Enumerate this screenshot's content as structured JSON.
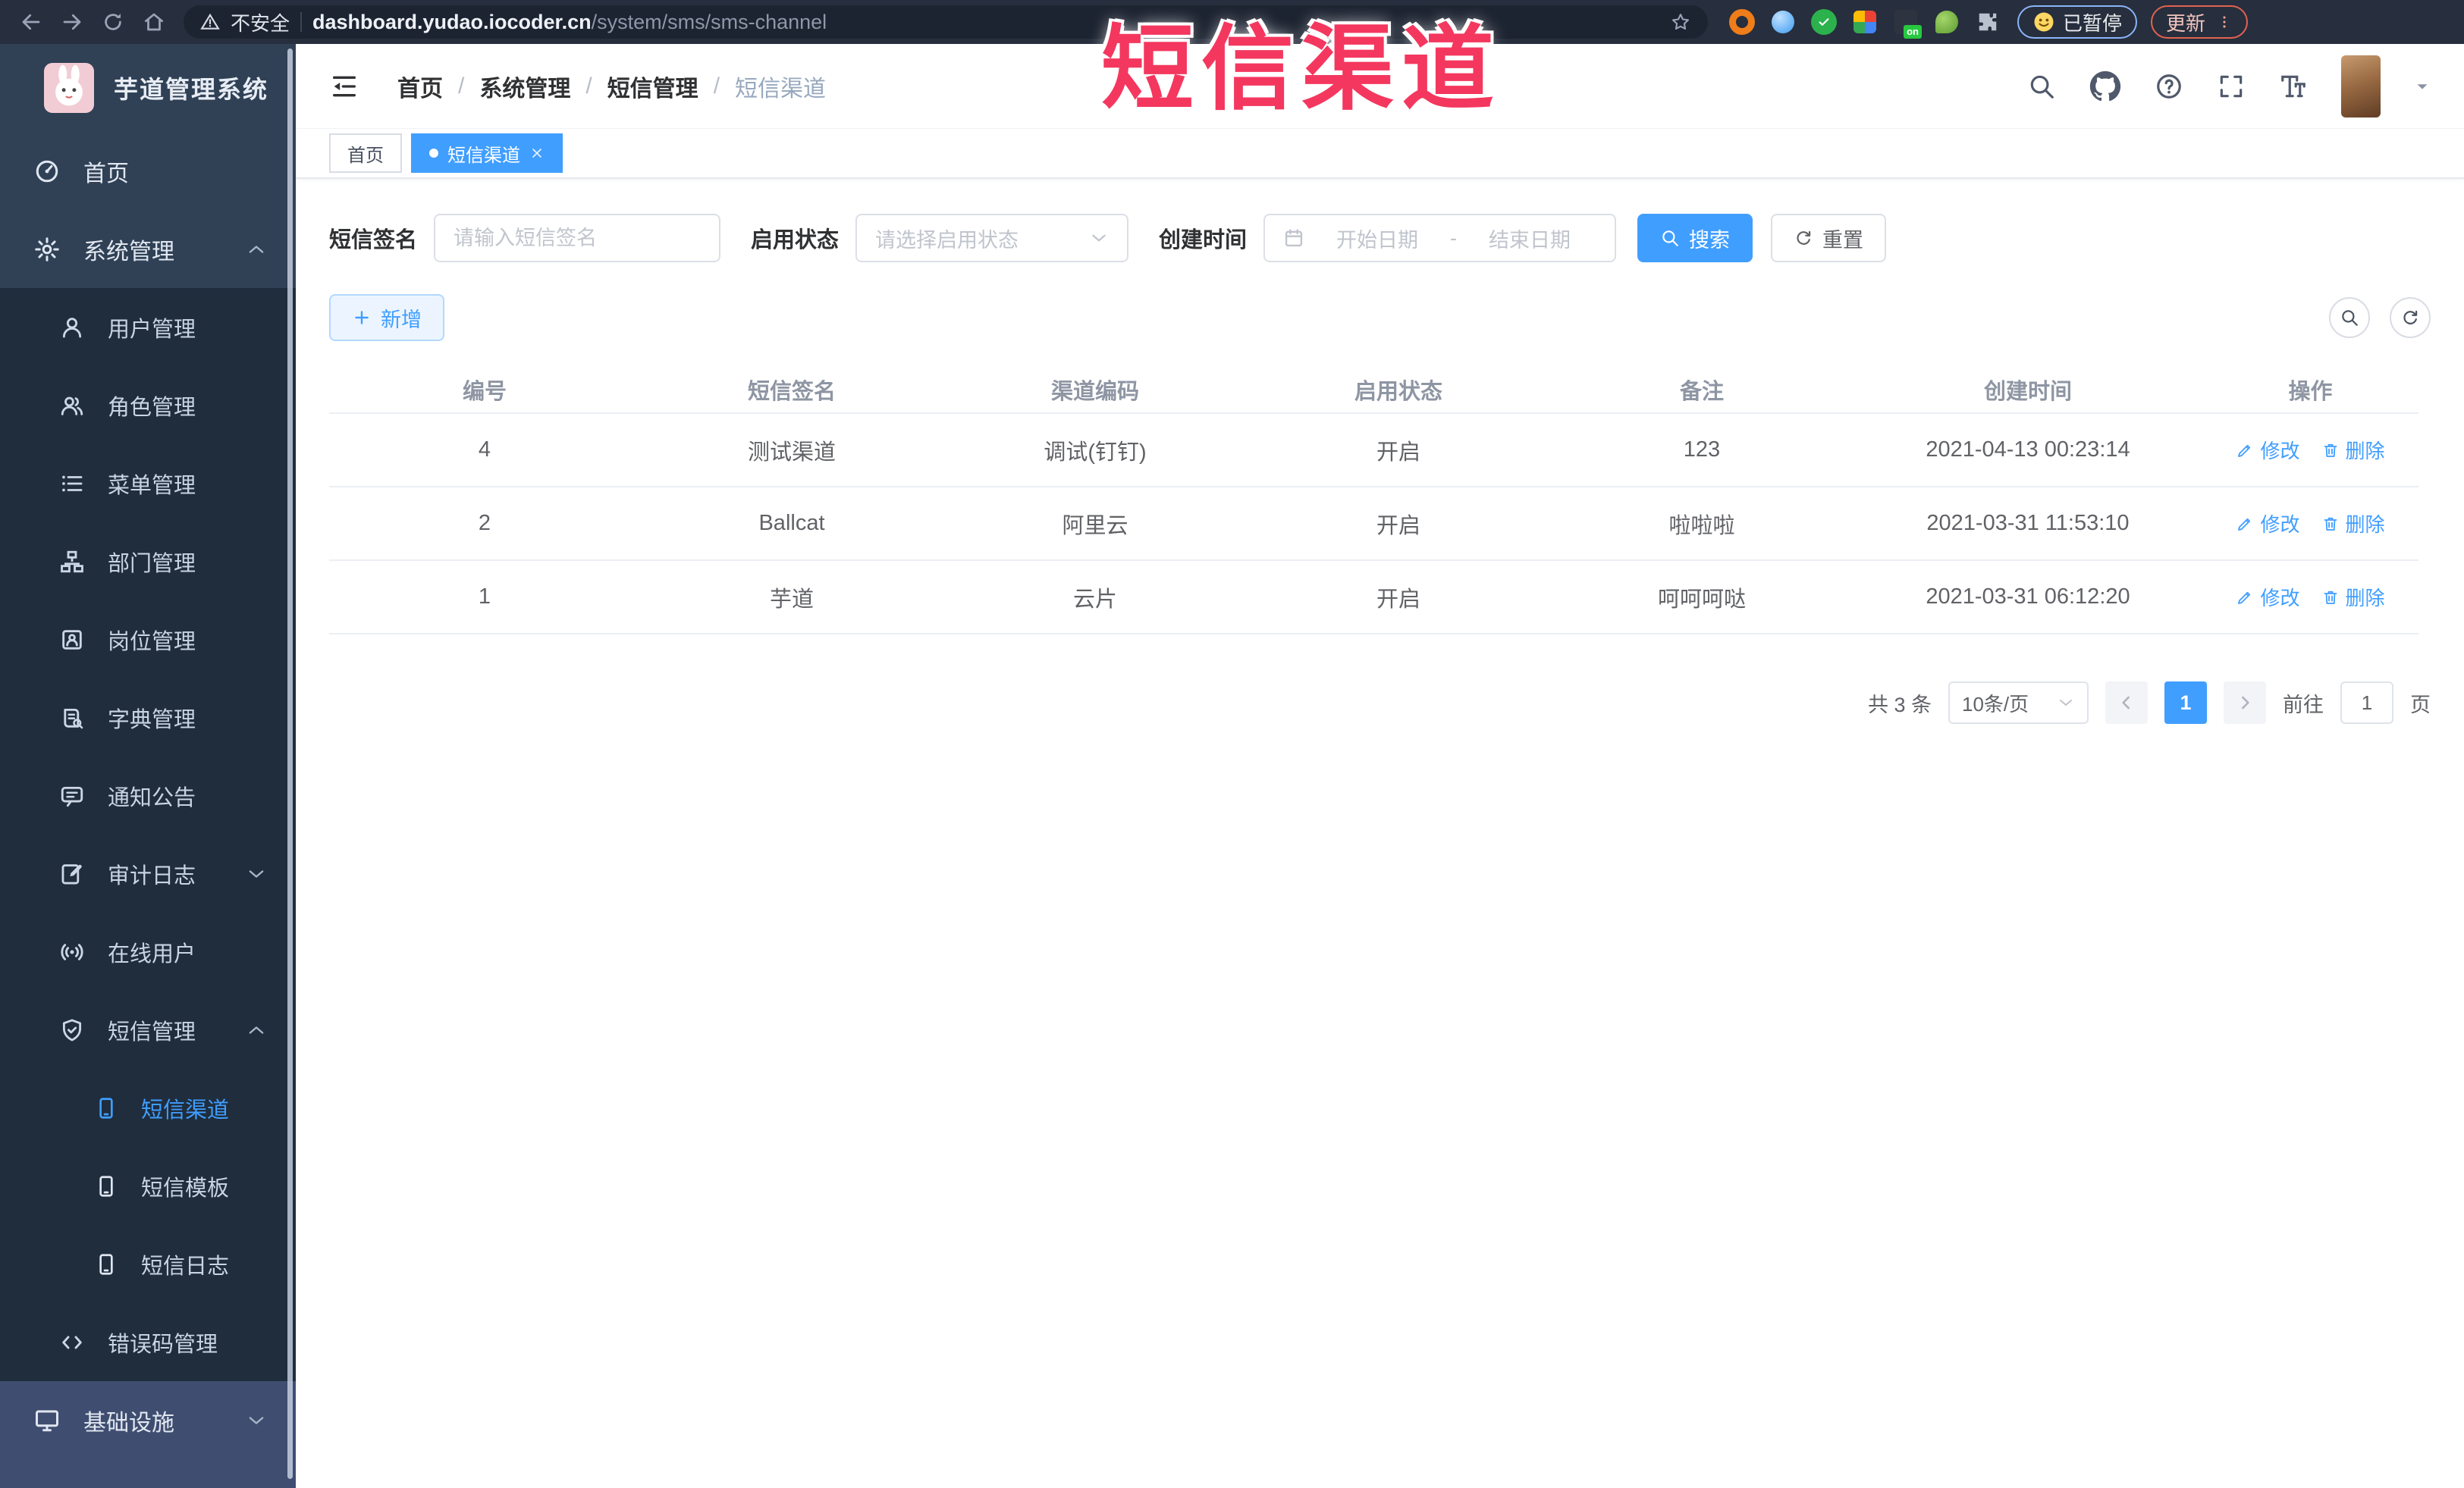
{
  "browser": {
    "security_label": "不安全",
    "url_domain": "dashboard.yudao.iocoder.cn",
    "url_path": "/system/sms/sms-channel",
    "extension_on_badge": "on",
    "paused_badge_label": "已暂停",
    "update_button_label": "更新"
  },
  "overlay": {
    "title": "短信渠道"
  },
  "sidebar": {
    "app_title": "芋道管理系统",
    "items": [
      {
        "label": "首页"
      },
      {
        "label": "系统管理"
      },
      {
        "label": "用户管理"
      },
      {
        "label": "角色管理"
      },
      {
        "label": "菜单管理"
      },
      {
        "label": "部门管理"
      },
      {
        "label": "岗位管理"
      },
      {
        "label": "字典管理"
      },
      {
        "label": "通知公告"
      },
      {
        "label": "审计日志"
      },
      {
        "label": "在线用户"
      },
      {
        "label": "短信管理"
      },
      {
        "label": "短信渠道"
      },
      {
        "label": "短信模板"
      },
      {
        "label": "短信日志"
      },
      {
        "label": "错误码管理"
      },
      {
        "label": "基础设施"
      }
    ]
  },
  "header": {
    "breadcrumb": [
      "首页",
      "系统管理",
      "短信管理",
      "短信渠道"
    ],
    "separator": "/"
  },
  "tabs": [
    {
      "label": "首页"
    },
    {
      "label": "短信渠道"
    }
  ],
  "filters": {
    "sign_label": "短信签名",
    "sign_placeholder": "请输入短信签名",
    "status_label": "启用状态",
    "status_placeholder": "请选择启用状态",
    "time_label": "创建时间",
    "start_placeholder": "开始日期",
    "range_separator": "-",
    "end_placeholder": "结束日期",
    "search_label": "搜索",
    "reset_label": "重置"
  },
  "toolbar": {
    "add_label": "新增"
  },
  "table": {
    "headers": [
      "编号",
      "短信签名",
      "渠道编码",
      "启用状态",
      "备注",
      "创建时间",
      "操作"
    ],
    "rows": [
      {
        "id": "4",
        "sign": "测试渠道",
        "code": "调试(钉钉)",
        "status": "开启",
        "remark": "123",
        "created": "2021-04-13 00:23:14"
      },
      {
        "id": "2",
        "sign": "Ballcat",
        "code": "阿里云",
        "status": "开启",
        "remark": "啦啦啦",
        "created": "2021-03-31 11:53:10"
      },
      {
        "id": "1",
        "sign": "芋道",
        "code": "云片",
        "status": "开启",
        "remark": "呵呵呵哒",
        "created": "2021-03-31 06:12:20"
      }
    ],
    "edit_label": "修改",
    "delete_label": "删除"
  },
  "pagination": {
    "total_label": "共 3 条",
    "page_size_label": "10条/页",
    "current_page": "1",
    "goto_label": "前往",
    "goto_value": "1",
    "page_unit_label": "页"
  },
  "colors": {
    "primary": "#409eff",
    "overlay_red": "#f4375e",
    "sidebar_bg": "#304156",
    "submenu_bg": "#1f2d3d"
  }
}
